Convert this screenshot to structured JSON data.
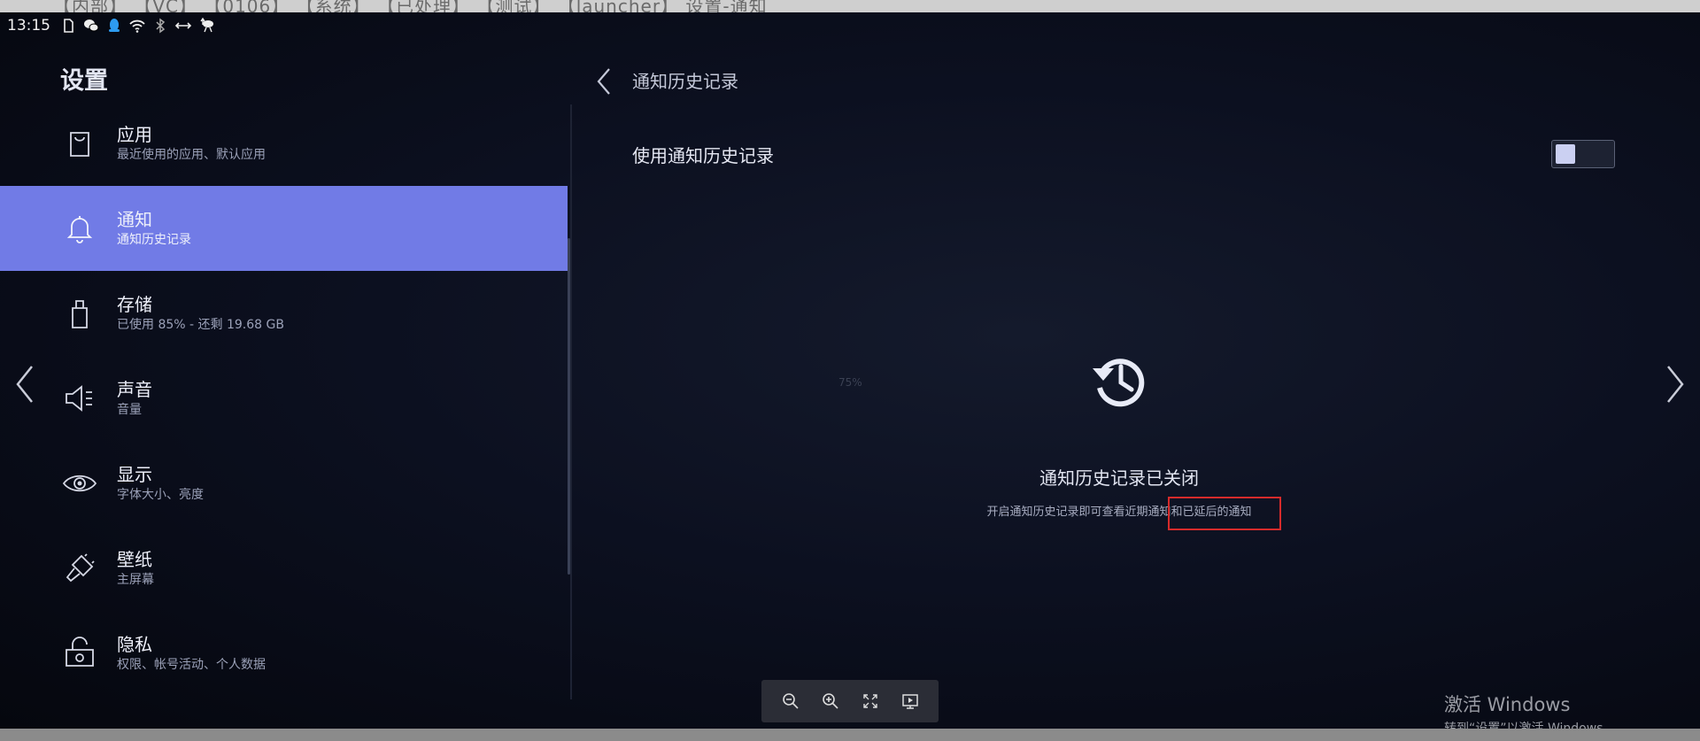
{
  "status_bar": {
    "time": "13:15"
  },
  "sidebar": {
    "title": "设置",
    "items": [
      {
        "label": "应用",
        "subtitle": "最近使用的应用、默认应用",
        "icon": "shopping-bag-icon",
        "active": false
      },
      {
        "label": "通知",
        "subtitle": "通知历史记录",
        "icon": "bell-icon",
        "active": true
      },
      {
        "label": "存储",
        "subtitle": "已使用 85% - 还剩 19.68 GB",
        "icon": "storage-icon",
        "active": false
      },
      {
        "label": "声音",
        "subtitle": "音量",
        "icon": "speaker-icon",
        "active": false
      },
      {
        "label": "显示",
        "subtitle": "字体大小、亮度",
        "icon": "eye-icon",
        "active": false
      },
      {
        "label": "壁纸",
        "subtitle": "主屏幕",
        "icon": "brush-icon",
        "active": false
      },
      {
        "label": "隐私",
        "subtitle": "权限、帐号活动、个人数据",
        "icon": "lock-icon",
        "active": false
      }
    ]
  },
  "detail": {
    "title": "通知历史记录",
    "setting_label": "使用通知历史记录",
    "toggle_on": false,
    "empty_title": "通知历史记录已关闭",
    "empty_desc": "开启通知历史记录即可查看近期通知和已延后的通知",
    "zoom_hint": "75%"
  },
  "watermark": {
    "title": "激活 Windows",
    "subtitle": "转到“设置”以激活 Windows。"
  },
  "colors": {
    "accent": "#717be6",
    "background": "#0c1020",
    "highlight": "#d62b2b"
  }
}
